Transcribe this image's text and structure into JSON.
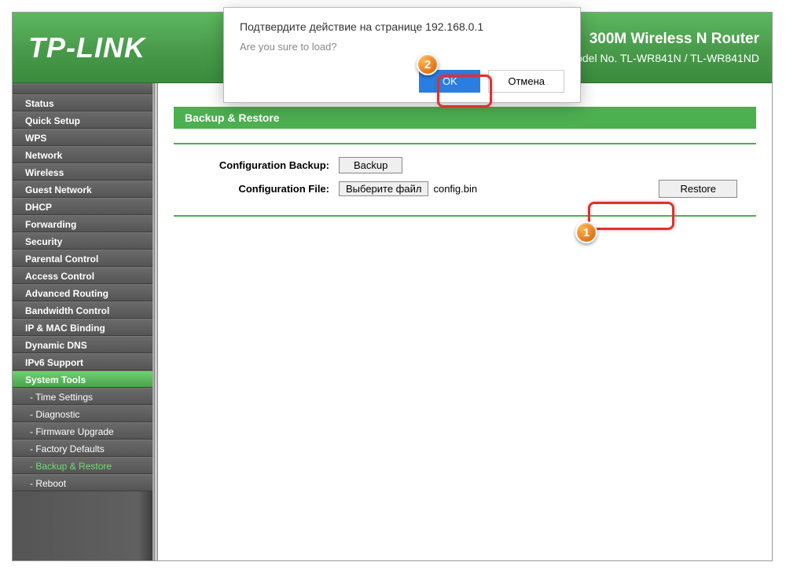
{
  "header": {
    "logo": "TP-LINK",
    "product_title": "300M Wireless N Router",
    "model": "Model No. TL-WR841N / TL-WR841ND"
  },
  "sidebar": {
    "items": [
      {
        "label": "Status",
        "sub": false
      },
      {
        "label": "Quick Setup",
        "sub": false
      },
      {
        "label": "WPS",
        "sub": false
      },
      {
        "label": "Network",
        "sub": false
      },
      {
        "label": "Wireless",
        "sub": false
      },
      {
        "label": "Guest Network",
        "sub": false
      },
      {
        "label": "DHCP",
        "sub": false
      },
      {
        "label": "Forwarding",
        "sub": false
      },
      {
        "label": "Security",
        "sub": false
      },
      {
        "label": "Parental Control",
        "sub": false
      },
      {
        "label": "Access Control",
        "sub": false
      },
      {
        "label": "Advanced Routing",
        "sub": false
      },
      {
        "label": "Bandwidth Control",
        "sub": false
      },
      {
        "label": "IP & MAC Binding",
        "sub": false
      },
      {
        "label": "Dynamic DNS",
        "sub": false
      },
      {
        "label": "IPv6 Support",
        "sub": false
      },
      {
        "label": "System Tools",
        "sub": false,
        "active": true
      },
      {
        "label": "- Time Settings",
        "sub": true
      },
      {
        "label": "- Diagnostic",
        "sub": true
      },
      {
        "label": "- Firmware Upgrade",
        "sub": true
      },
      {
        "label": "- Factory Defaults",
        "sub": true
      },
      {
        "label": "- Backup & Restore",
        "sub": true,
        "current": true
      },
      {
        "label": "- Reboot",
        "sub": true
      }
    ]
  },
  "main": {
    "panel_title": "Backup & Restore",
    "backup_label": "Configuration Backup:",
    "backup_button": "Backup",
    "file_label": "Configuration File:",
    "file_button": "Выберите файл",
    "file_name": "config.bin",
    "restore_button": "Restore"
  },
  "dialog": {
    "title": "Подтвердите действие на странице 192.168.0.1",
    "message": "Are you sure to load?",
    "ok": "OK",
    "cancel": "Отмена"
  },
  "callouts": {
    "one": "1",
    "two": "2"
  }
}
